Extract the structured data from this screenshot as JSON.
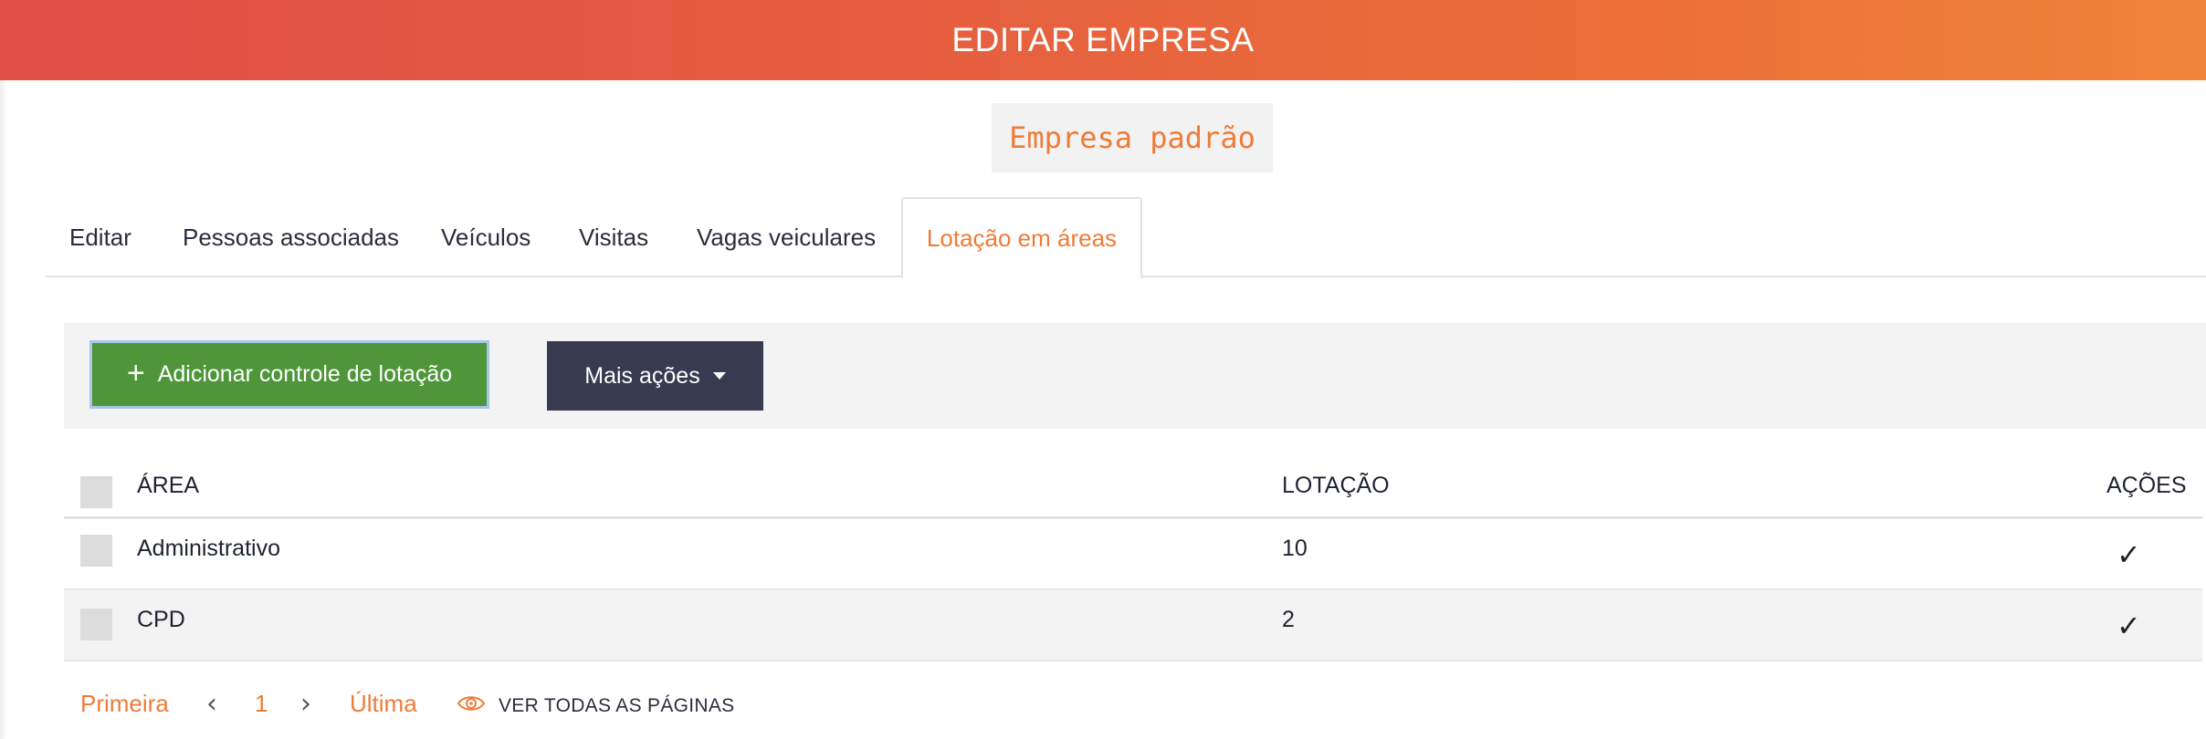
{
  "header": {
    "title": "EDITAR EMPRESA"
  },
  "company": {
    "name": "Empresa padrão"
  },
  "tabs": [
    {
      "label": "Editar",
      "active": false
    },
    {
      "label": "Pessoas associadas",
      "active": false
    },
    {
      "label": "Veículos",
      "active": false
    },
    {
      "label": "Visitas",
      "active": false
    },
    {
      "label": "Vagas veiculares",
      "active": false
    },
    {
      "label": "Lotação em áreas",
      "active": true
    }
  ],
  "toolbar": {
    "add_label": "Adicionar controle de lotação",
    "add_icon": "plus-icon",
    "more_label": "Mais ações",
    "more_icon": "caret-down-icon"
  },
  "table": {
    "columns": [
      "ÁREA",
      "LOTAÇÃO",
      "AÇÕES"
    ],
    "rows": [
      {
        "area": "Administrativo",
        "lotacao": "10",
        "action_icon": "check-icon"
      },
      {
        "area": "CPD",
        "lotacao": "2",
        "action_icon": "check-icon"
      }
    ]
  },
  "pagination": {
    "first": "Primeira",
    "current": "1",
    "last": "Última",
    "view_all": "VER TODAS AS PÁGINAS",
    "view_all_icon": "eye-icon"
  },
  "colors": {
    "accent": "#ef7b39",
    "header_gradient_start": "#e04e46",
    "header_gradient_end": "#f0843a",
    "add_button": "#4f963a",
    "more_button": "#383a4f"
  }
}
